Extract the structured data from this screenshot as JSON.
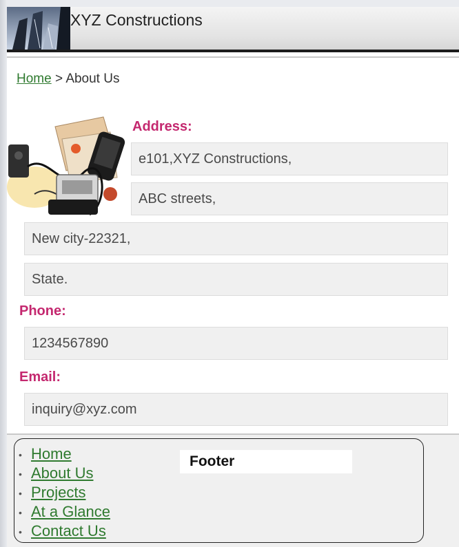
{
  "header": {
    "title": "XYZ Constructions"
  },
  "breadcrumb": {
    "home_label": "Home",
    "separator": ">",
    "current": "About Us"
  },
  "contact": {
    "address_label": "Address:",
    "address_lines": [
      "e101,XYZ Constructions,",
      "ABC streets,",
      "New city-22321,",
      "State."
    ],
    "phone_label": "Phone:",
    "phone_value": "1234567890",
    "email_label": "Email:",
    "email_value": "inquiry@xyz.com"
  },
  "footer": {
    "nav": [
      "Home",
      "About Us",
      "Projects",
      "At a Glance",
      "Contact Us"
    ],
    "label": "Footer"
  },
  "colors": {
    "label_accent": "#c4286f",
    "link": "#2f7a2f",
    "field_bg": "#f0f0f0"
  },
  "icons": {
    "logo": "building-skyline-icon",
    "decor": "office-gadgets-illustration"
  }
}
